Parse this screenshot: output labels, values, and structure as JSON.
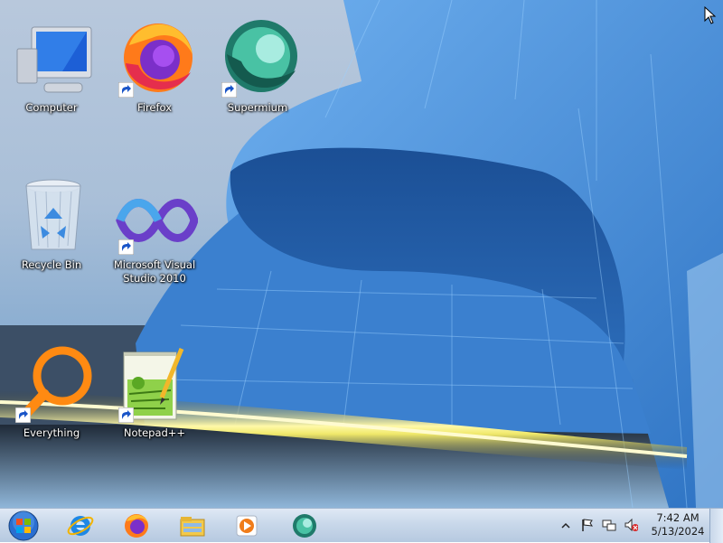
{
  "desktop": {
    "icons": [
      {
        "label": "Computer",
        "icon": "computer-icon",
        "shortcut": false
      },
      {
        "label": "Firefox",
        "icon": "firefox-icon",
        "shortcut": true
      },
      {
        "label": "Supermium",
        "icon": "supermium-icon",
        "shortcut": true
      },
      {
        "label": "Recycle Bin",
        "icon": "recycle-bin-icon",
        "shortcut": false
      },
      {
        "label": "Microsoft Visual Studio 2010",
        "icon": "visual-studio-icon",
        "shortcut": true
      },
      {
        "label": "Everything",
        "icon": "everything-search-icon",
        "shortcut": true
      },
      {
        "label": "Notepad++",
        "icon": "notepad-plus-plus-icon",
        "shortcut": true
      }
    ]
  },
  "taskbar": {
    "start": {
      "icon": "windows-start-orb-icon"
    },
    "pinned": [
      {
        "icon": "internet-explorer-icon"
      },
      {
        "icon": "firefox-icon"
      },
      {
        "icon": "file-explorer-icon"
      },
      {
        "icon": "media-player-icon"
      },
      {
        "icon": "supermium-icon"
      }
    ],
    "tray": {
      "icons": [
        "show-hidden-icons-chevron-icon",
        "action-center-flag-icon",
        "network-icon",
        "volume-muted-icon"
      ],
      "time": "7:42 AM",
      "date": "5/13/2024"
    }
  },
  "colors": {
    "taskbar": "#c9d8ea",
    "wallpaper_blue": "#3f86d4",
    "label_text": "#ffffff"
  }
}
